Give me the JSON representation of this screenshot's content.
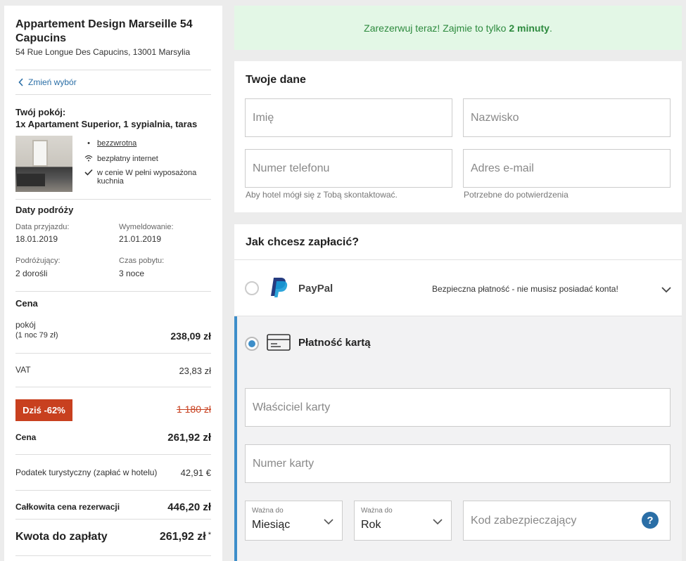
{
  "hotel": {
    "name": "Appartement Design Marseille 54 Capucins",
    "address": "54 Rue Longue Des Capucins, 13001 Marsylia"
  },
  "back_link": "Zmień wybór",
  "room": {
    "title_line1": "Twój pokój:",
    "title_line2": "1x Apartament Superior, 1 sypialnia, taras",
    "features": [
      {
        "icon": "bullet-icon",
        "text": "bezzwrotna"
      },
      {
        "icon": "wifi-icon",
        "text": "bezpłatny internet"
      },
      {
        "icon": "check-icon",
        "text": "w cenie W pełni wyposażona kuchnia"
      }
    ]
  },
  "travel": {
    "title": "Daty podróży",
    "checkin_label": "Data przyjazdu:",
    "checkin": "18.01.2019",
    "checkout_label": "Wymeldowanie:",
    "checkout": "21.01.2019",
    "guests_label": "Podróżujący:",
    "guests": "2 dorośli",
    "stay_label": "Czas pobytu:",
    "stay": "3 noce"
  },
  "price": {
    "title": "Cena",
    "room_label": "pokój",
    "room_sub": "(1 noc 79 zł)",
    "room_value": "238,09 zł",
    "vat_label": "VAT",
    "vat_value": "23,83 zł",
    "discount_badge": "Dziś -62%",
    "old_price": "1 180 zł",
    "price_label": "Cena",
    "price_value": "261,92 zł",
    "tax_label": "Podatek turystyczny (zapłać w hotelu)",
    "tax_value": "42,91 €",
    "total_label": "Całkowita cena rezerwacji",
    "total_value": "446,20 zł",
    "due_label": "Kwota do zapłaty",
    "due_value": "261,92 zł",
    "due_asterisk": "*"
  },
  "banner": {
    "text": "Zarezerwuj teraz! Zajmie to tylko ",
    "bold": "2 minuty",
    "end": "."
  },
  "personal": {
    "title": "Twoje dane",
    "first_name_placeholder": "Imię",
    "last_name_placeholder": "Nazwisko",
    "phone_placeholder": "Numer telefonu",
    "email_placeholder": "Adres e-mail",
    "phone_hint": "Aby hotel mógł się z Tobą skontaktować.",
    "email_hint": "Potrzebne do potwierdzenia"
  },
  "payment": {
    "title": "Jak chcesz zapłacić?",
    "paypal_label": "PayPal",
    "paypal_note": "Bezpieczna płatność - nie musisz posiadać konta!",
    "card_label": "Płatność kartą",
    "card_owner_placeholder": "Właściciel karty",
    "card_number_placeholder": "Numer karty",
    "month_small": "Ważna do",
    "month_value": "Miesiąc",
    "year_small": "Ważna do",
    "year_value": "Rok",
    "cvc_placeholder": "Kod zabezpieczający",
    "help": "?"
  },
  "colors": {
    "accent": "#3d8ec9",
    "discount": "#c8401f",
    "banner_bg": "#e3f7e6",
    "banner_text": "#2d8a3e"
  }
}
